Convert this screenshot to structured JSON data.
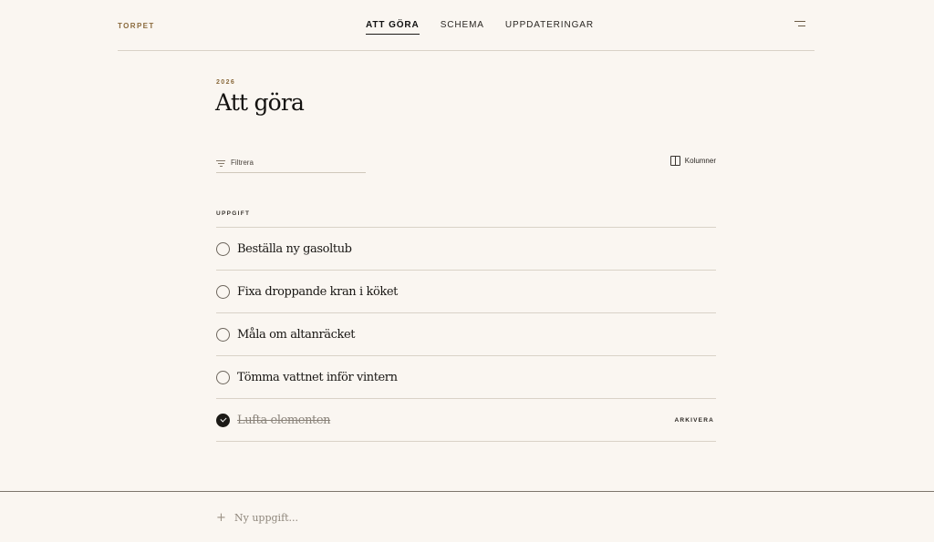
{
  "brand": "TORPET",
  "nav": {
    "items": [
      {
        "label": "ATT GÖRA",
        "active": true
      },
      {
        "label": "SCHEMA",
        "active": false
      },
      {
        "label": "UPPDATERINGAR",
        "active": false
      }
    ],
    "menu_icon": "menu-icon"
  },
  "header": {
    "year": "2026",
    "title": "Att göra"
  },
  "toolbar": {
    "filter_icon": "filter-icon",
    "filter_label": "Filtrera",
    "columns_icon": "columns-icon",
    "columns_label": "Kolumner"
  },
  "table": {
    "column_header": "UPPGIFT",
    "tasks": [
      {
        "label": "Beställa ny gasoltub",
        "done": false
      },
      {
        "label": "Fixa droppande kran i köket",
        "done": false
      },
      {
        "label": "Måla om altanräcket",
        "done": false
      },
      {
        "label": "Tömma vattnet inför vintern",
        "done": false
      },
      {
        "label": "Lufta elementen",
        "done": true,
        "action": "ARKIVERA"
      }
    ]
  },
  "composer": {
    "plus_icon": "plus-icon",
    "plus_glyph": "+",
    "placeholder": "Ny uppgift..."
  }
}
